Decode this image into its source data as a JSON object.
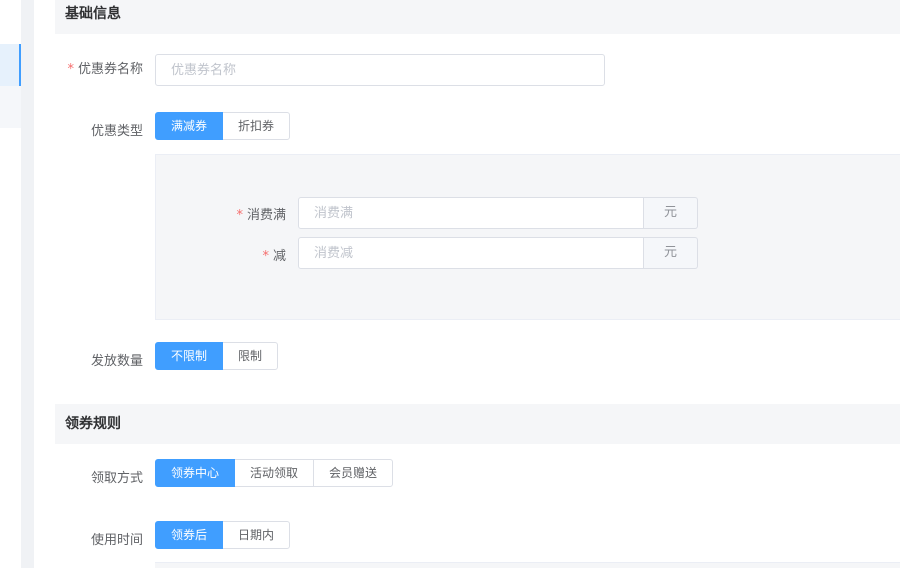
{
  "sections": {
    "basic_info": "基础信息",
    "claim_rules": "领券规则"
  },
  "coupon_name": {
    "label": "优惠券名称",
    "required_mark": "*",
    "placeholder": "优惠券名称"
  },
  "discount_type": {
    "label": "优惠类型",
    "options": [
      "满减券",
      "折扣券"
    ],
    "selected": "满减券"
  },
  "spend_threshold": {
    "label": "消费满",
    "required_mark": "*",
    "placeholder": "消费满",
    "unit": "元"
  },
  "reduction": {
    "label": "减",
    "required_mark": "*",
    "placeholder": "消费减",
    "unit": "元"
  },
  "issue_quantity": {
    "label": "发放数量",
    "options": [
      "不限制",
      "限制"
    ],
    "selected": "不限制"
  },
  "claim_method": {
    "label": "领取方式",
    "options": [
      "领券中心",
      "活动领取",
      "会员赠送"
    ],
    "selected": "领券中心"
  },
  "usage_time": {
    "label": "使用时间",
    "options": [
      "领券后",
      "日期内"
    ],
    "selected": "领券后"
  },
  "colors": {
    "primary": "#409eff",
    "required": "#f56c6c",
    "panel_bg": "#f5f6f8"
  }
}
